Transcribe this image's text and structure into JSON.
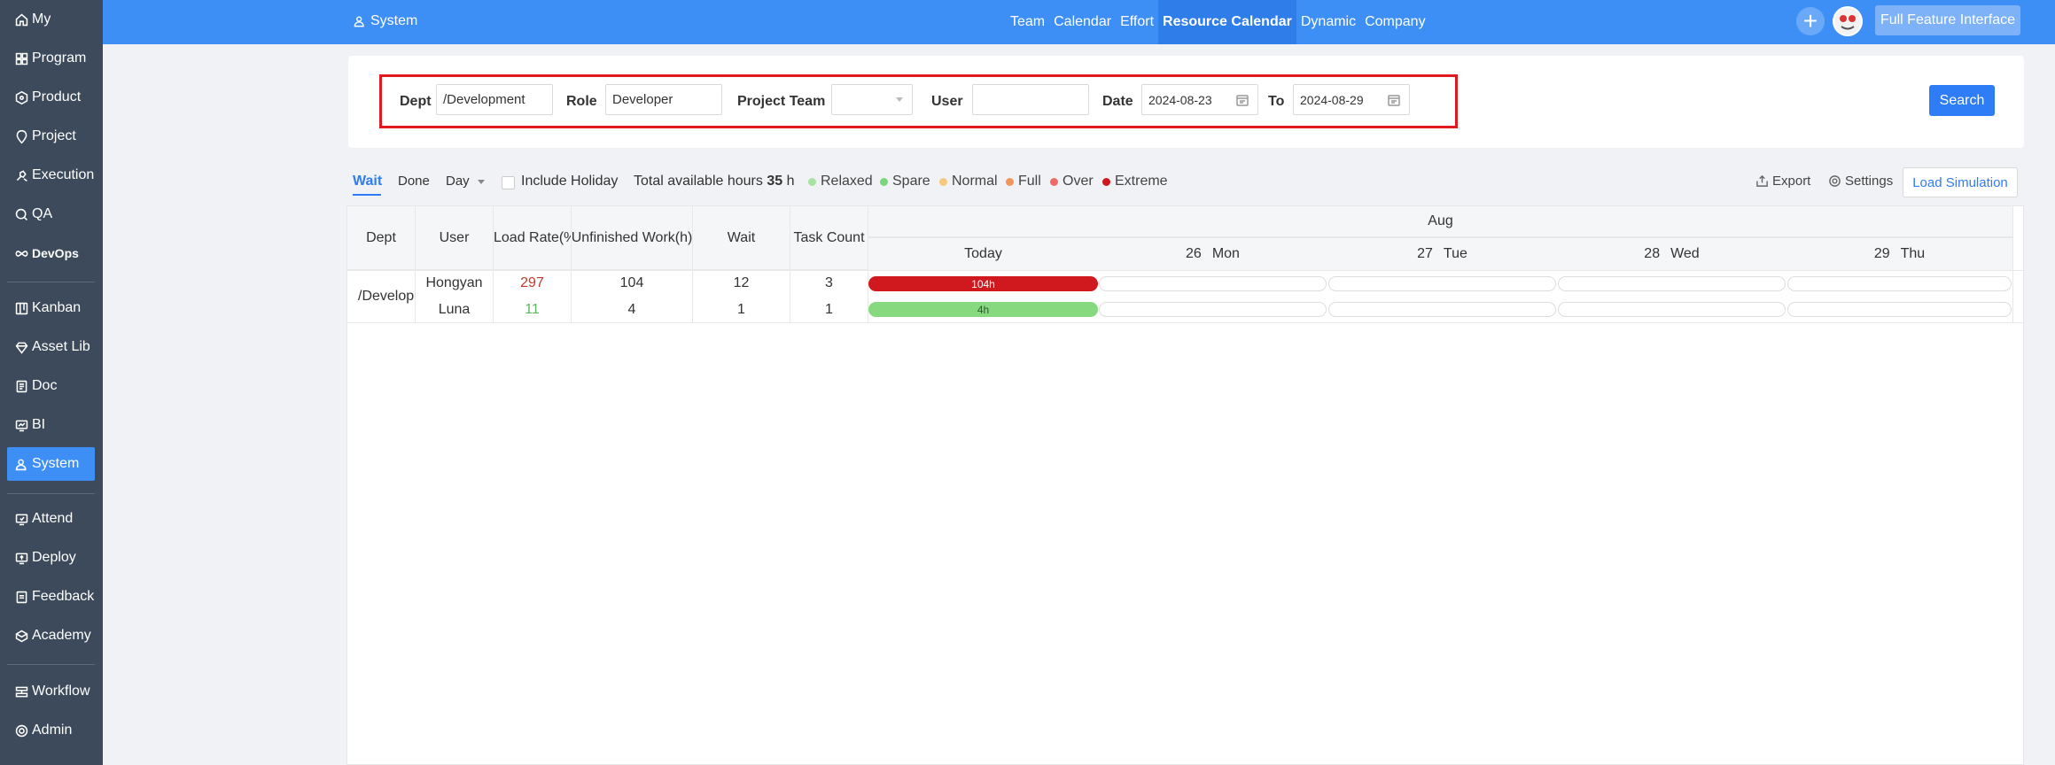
{
  "sidebar": {
    "items": [
      {
        "label": "My",
        "icon": "home-icon"
      },
      {
        "label": "Program",
        "icon": "grid-icon"
      },
      {
        "label": "Product",
        "icon": "product-icon"
      },
      {
        "label": "Project",
        "icon": "project-icon"
      },
      {
        "label": "Execution",
        "icon": "execution-icon"
      },
      {
        "label": "QA",
        "icon": "qa-icon"
      },
      {
        "label": "DevOps",
        "icon": "infinity-icon"
      },
      {
        "label": "Kanban",
        "icon": "kanban-icon"
      },
      {
        "label": "Asset Lib",
        "icon": "diamond-icon"
      },
      {
        "label": "Doc",
        "icon": "doc-icon"
      },
      {
        "label": "BI",
        "icon": "bi-icon"
      },
      {
        "label": "System",
        "icon": "users-icon"
      },
      {
        "label": "Attend",
        "icon": "attend-icon"
      },
      {
        "label": "Deploy",
        "icon": "deploy-icon"
      },
      {
        "label": "Feedback",
        "icon": "feedback-icon"
      },
      {
        "label": "Academy",
        "icon": "academy-icon"
      },
      {
        "label": "Workflow",
        "icon": "workflow-icon"
      },
      {
        "label": "Admin",
        "icon": "gear-icon"
      }
    ],
    "active": "System"
  },
  "topbar": {
    "breadcrumb": "System",
    "nav": [
      "Team",
      "Calendar",
      "Effort",
      "Resource Calendar",
      "Dynamic",
      "Company"
    ],
    "active_nav": "Resource Calendar",
    "plus": "+",
    "full_feature": "Full Feature Interface"
  },
  "filters": {
    "dept_label": "Dept",
    "dept_value": "/Development",
    "role_label": "Role",
    "role_value": "Developer",
    "team_label": "Project Team",
    "team_value": "",
    "user_label": "User",
    "user_value": "",
    "date_label": "Date",
    "date_from": "2024-08-23",
    "to_label": "To",
    "date_to": "2024-08-29",
    "search": "Search"
  },
  "toolbar": {
    "tab_wait": "Wait",
    "tab_done": "Done",
    "day_select": "Day",
    "include_holiday": "Include Holiday",
    "total_prefix": "Total available hours",
    "total_hours": "35",
    "total_unit": "h",
    "legend": [
      {
        "label": "Relaxed",
        "color": "#a8e2a0"
      },
      {
        "label": "Spare",
        "color": "#7ad67a"
      },
      {
        "label": "Normal",
        "color": "#f7c97e"
      },
      {
        "label": "Full",
        "color": "#f3955a"
      },
      {
        "label": "Over",
        "color": "#f06a6a"
      },
      {
        "label": "Extreme",
        "color": "#d0191f"
      }
    ],
    "export": "Export",
    "settings": "Settings",
    "load_simulation": "Load Simulation"
  },
  "table": {
    "headers": {
      "dept": "Dept",
      "user": "User",
      "load_rate": "Load Rate(%)",
      "unfinished": "Unfinished Work(h)",
      "wait": "Wait",
      "task_count": "Task Count"
    },
    "month": "Aug",
    "days": [
      {
        "num": "",
        "label": "Today"
      },
      {
        "num": "26",
        "label": "Mon"
      },
      {
        "num": "27",
        "label": "Tue"
      },
      {
        "num": "28",
        "label": "Wed"
      },
      {
        "num": "29",
        "label": "Thu"
      }
    ],
    "dept_value": "/Development",
    "rows": [
      {
        "user": "Hongyan",
        "load_rate": "297",
        "unfinished": "104",
        "wait": "12",
        "tasks": "3",
        "bar_label": "104h",
        "bar_color": "#d0191f",
        "rate_color": "#c0392b"
      },
      {
        "user": "Luna",
        "load_rate": "11",
        "unfinished": "4",
        "wait": "1",
        "tasks": "1",
        "bar_label": "4h",
        "bar_color": "#86d97f",
        "rate_color": "#5cb85c"
      }
    ]
  }
}
